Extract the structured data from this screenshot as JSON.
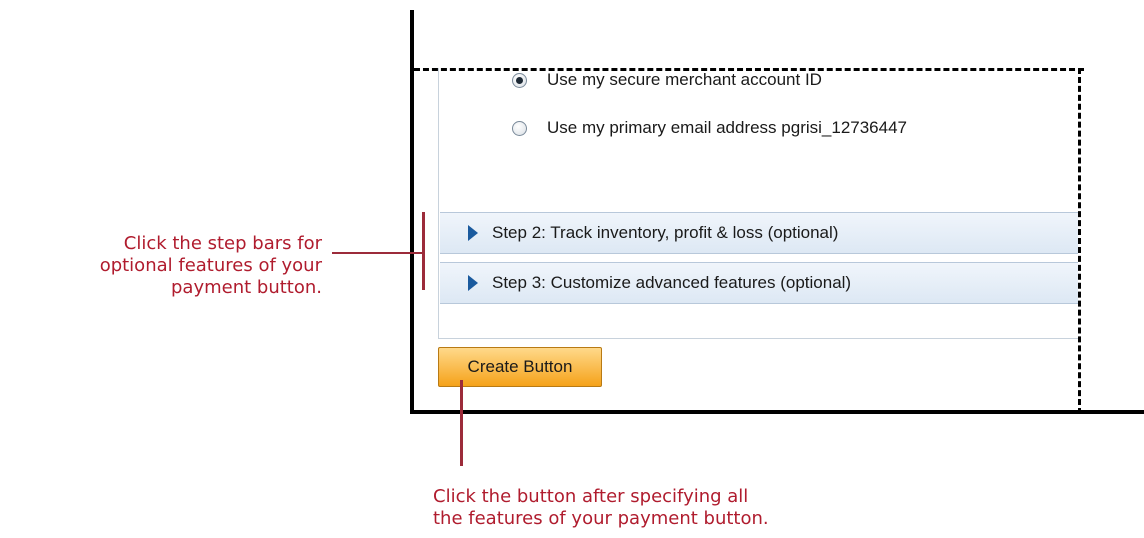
{
  "radio_options": [
    {
      "label": "Use my secure merchant account ID",
      "checked": true
    },
    {
      "label": "Use my primary email address pgrisi_12736447",
      "checked": false
    }
  ],
  "steps": [
    {
      "label": "Step 2: Track inventory, profit & loss (optional)"
    },
    {
      "label": "Step 3: Customize advanced features (optional)"
    }
  ],
  "create_button": {
    "label": "Create Button"
  },
  "callouts": {
    "steps_note": [
      "Click the step bars for",
      "optional features of your",
      "payment button."
    ],
    "button_note": [
      "Click the button after specifying all",
      "the features of your payment button."
    ]
  },
  "colors": {
    "annotation": "#b01c2e",
    "step_triangle": "#1a5a9e",
    "button_fill": "#f5a21a"
  },
  "icons": {
    "step_expand": "triangle-right-icon",
    "radio_selected": "radio-selected-icon",
    "radio_unselected": "radio-unselected-icon"
  }
}
